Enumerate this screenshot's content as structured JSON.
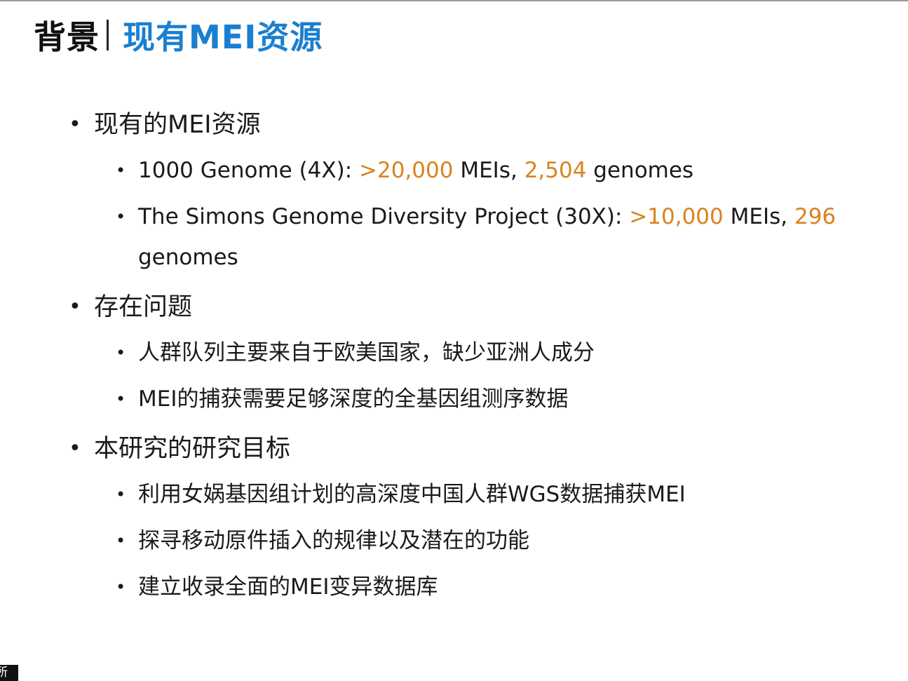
{
  "header": {
    "prefix": "背景",
    "title": "现有MEI资源"
  },
  "sections": [
    {
      "heading": "现有的MEI资源",
      "items": [
        {
          "seg0": "1000 Genome (4X): ",
          "hl1": ">20,000",
          "seg1": " MEIs, ",
          "hl2": "2,504",
          "seg2": " genomes"
        },
        {
          "seg0": "The Simons Genome Diversity Project (30X): ",
          "hl1": ">10,000",
          "seg1": " MEIs, ",
          "hl2": "296",
          "seg2": " genomes"
        }
      ]
    },
    {
      "heading": "存在问题",
      "items": [
        "人群队列主要来自于欧美国家，缺少亚洲人成分",
        "MEI的捕获需要足够深度的全基因组测序数据"
      ]
    },
    {
      "heading": "本研究的研究目标",
      "items": [
        "利用女娲基因组计划的高深度中国人群WGS数据捕获MEI",
        "探寻移动原件插入的规律以及潜在的功能",
        "建立收录全面的MEI变异数据库"
      ]
    }
  ],
  "corner_text": "所",
  "colors": {
    "title_blue": "#1a7fd0",
    "highlight_orange": "#d9831f",
    "text": "#1a1a1a"
  }
}
